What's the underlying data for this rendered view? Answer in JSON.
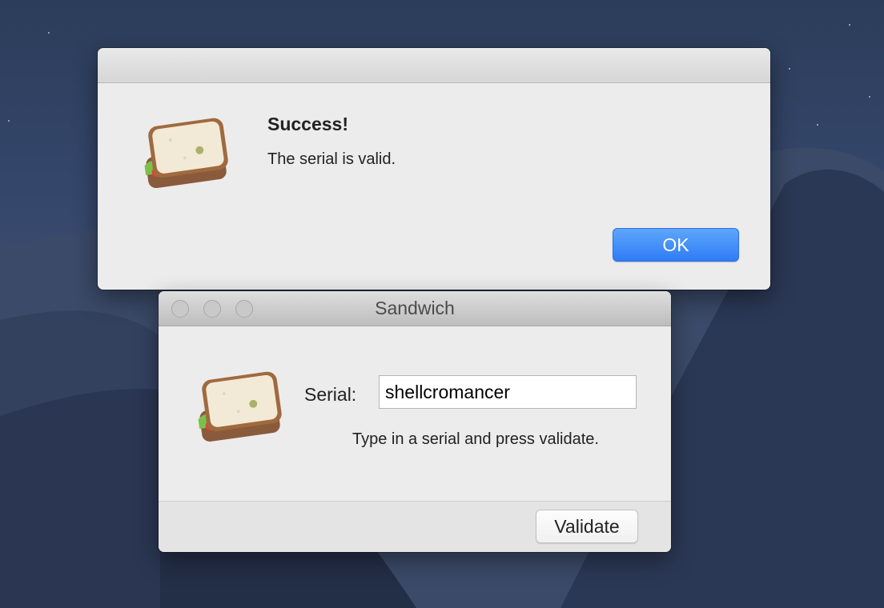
{
  "alert": {
    "title": "Success!",
    "message": "The serial is valid.",
    "ok_label": "OK",
    "icon": "sandwich-icon"
  },
  "window": {
    "title": "Sandwich",
    "icon": "sandwich-icon",
    "serial_label": "Serial:",
    "serial_value": "shellcromancer",
    "hint": "Type in a serial and press validate.",
    "validate_label": "Validate"
  },
  "colors": {
    "accent": "#2f7cf6",
    "window_bg": "#ececec"
  }
}
